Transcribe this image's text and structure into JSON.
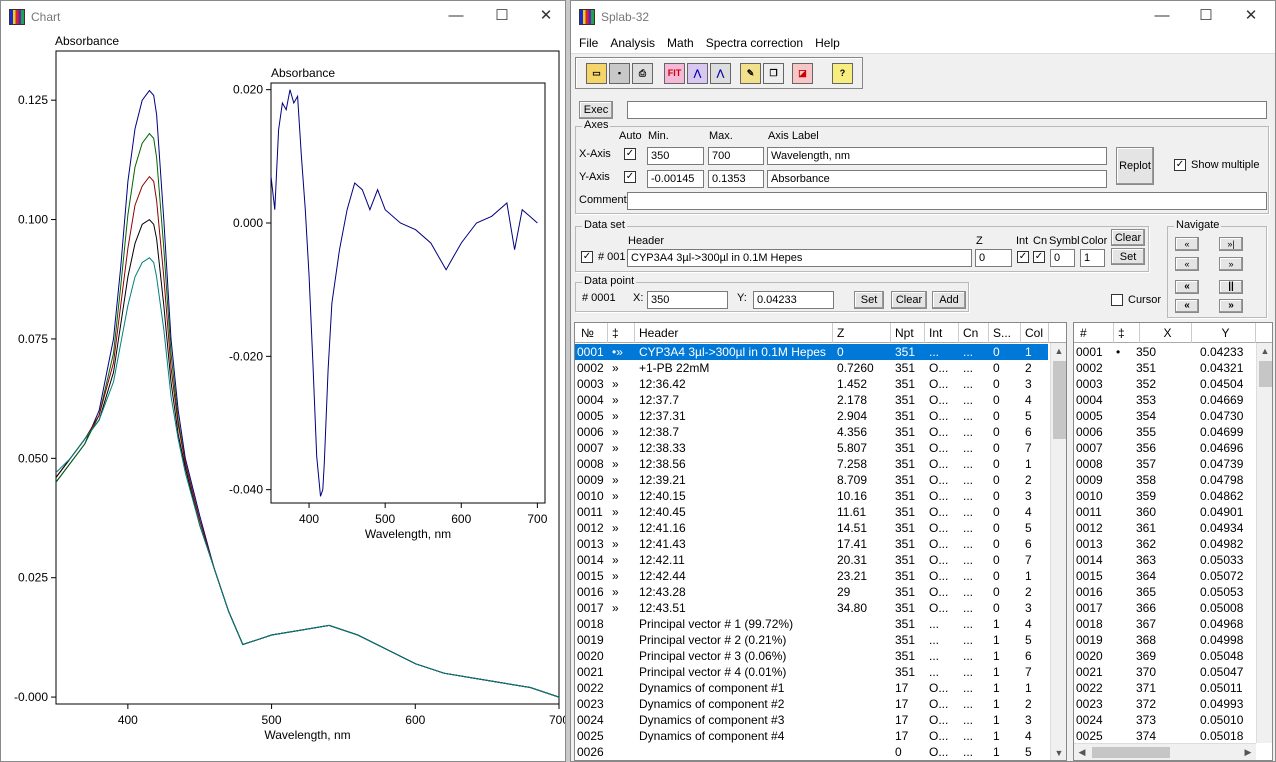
{
  "chart_window": {
    "title": "Chart",
    "controls": {
      "minimize": "—",
      "maximize": "☐",
      "close": "✕"
    }
  },
  "splab_window": {
    "title": "Splab-32",
    "controls": {
      "minimize": "—",
      "maximize": "☐",
      "close": "✕"
    },
    "menu": [
      "File",
      "Analysis",
      "Math",
      "Spectra correction",
      "Help"
    ],
    "toolbar_icons": [
      "open-folder-icon",
      "save-disk-icon",
      "print-icon",
      "fit-icon",
      "spectrum-icon",
      "spectrum-sum-icon",
      "pencil-icon",
      "copy-icon",
      "eraser-icon",
      "help-icon"
    ],
    "toolbar_labels": {
      "fit": "FIT",
      "help": "?"
    },
    "exec": {
      "label": "Exec",
      "value": ""
    },
    "axes": {
      "group_label": "Axes",
      "col_auto": "Auto",
      "col_min": "Min.",
      "col_max": "Max.",
      "col_axis_label": "Axis Label",
      "x_label": "X-Axis",
      "x_min": "350",
      "x_max": "700",
      "x_axis_label": "Wavelength, nm",
      "y_label": "Y-Axis",
      "y_min": "-0.00145",
      "y_max": "0.1353",
      "y_axis_label": "Absorbance",
      "comment_label": "Comment",
      "comment_value": "",
      "replot": "Replot",
      "show_multiple": "Show multiple"
    },
    "dataset": {
      "group_label": "Data set",
      "header_label": "Header",
      "z_label": "Z",
      "int_label": "Int",
      "cn_label": "Cn",
      "symbl_label": "Symbl",
      "color_label": "Color",
      "number": "# 001",
      "header_value": "CYP3A4 3µl->300µl in 0.1M Hepes",
      "z_value": "0",
      "symbl_value": "0",
      "color_value": "1",
      "clear": "Clear",
      "set": "Set"
    },
    "navigate": {
      "group_label": "Navigate",
      "buttons": [
        "«",
        "»|",
        "«",
        "»",
        "«",
        "||",
        "«",
        "»"
      ]
    },
    "datapoint": {
      "group_label": "Data point",
      "number": "# 0001",
      "x_label": "X:",
      "x_value": "350",
      "y_label": "Y:",
      "y_value": "0.04233",
      "set": "Set",
      "clear": "Clear",
      "add": "Add",
      "cursor": "Cursor"
    },
    "spectra_table": {
      "headers": [
        "№",
        "‡",
        "Header",
        "Z",
        "Npt",
        "Int",
        "Cn",
        "S...",
        "Col"
      ],
      "rows": [
        [
          "0001",
          "•»",
          "CYP3A4 3µl->300µl in 0.1M Hepes",
          "0",
          "351",
          "...",
          "...",
          "0",
          "1"
        ],
        [
          "0002",
          "»",
          "+1-PB 22mM",
          "0.7260",
          "351",
          "O...",
          "...",
          "0",
          "2"
        ],
        [
          "0003",
          "»",
          "12:36.42",
          "1.452",
          "351",
          "O...",
          "...",
          "0",
          "3"
        ],
        [
          "0004",
          "»",
          "12:37.7",
          "2.178",
          "351",
          "O...",
          "...",
          "0",
          "4"
        ],
        [
          "0005",
          "»",
          "12:37.31",
          "2.904",
          "351",
          "O...",
          "...",
          "0",
          "5"
        ],
        [
          "0006",
          "»",
          "12:38.7",
          "4.356",
          "351",
          "O...",
          "...",
          "0",
          "6"
        ],
        [
          "0007",
          "»",
          "12:38.33",
          "5.807",
          "351",
          "O...",
          "...",
          "0",
          "7"
        ],
        [
          "0008",
          "»",
          "12:38.56",
          "7.258",
          "351",
          "O...",
          "...",
          "0",
          "1"
        ],
        [
          "0009",
          "»",
          "12:39.21",
          "8.709",
          "351",
          "O...",
          "...",
          "0",
          "2"
        ],
        [
          "0010",
          "»",
          "12:40.15",
          "10.16",
          "351",
          "O...",
          "...",
          "0",
          "3"
        ],
        [
          "0011",
          "»",
          "12:40.45",
          "11.61",
          "351",
          "O...",
          "...",
          "0",
          "4"
        ],
        [
          "0012",
          "»",
          "12:41.16",
          "14.51",
          "351",
          "O...",
          "...",
          "0",
          "5"
        ],
        [
          "0013",
          "»",
          "12:41.43",
          "17.41",
          "351",
          "O...",
          "...",
          "0",
          "6"
        ],
        [
          "0014",
          "»",
          "12:42.11",
          "20.31",
          "351",
          "O...",
          "...",
          "0",
          "7"
        ],
        [
          "0015",
          "»",
          "12:42.44",
          "23.21",
          "351",
          "O...",
          "...",
          "0",
          "1"
        ],
        [
          "0016",
          "»",
          "12:43.28",
          "29",
          "351",
          "O...",
          "...",
          "0",
          "2"
        ],
        [
          "0017",
          "»",
          "12:43.51",
          "34.80",
          "351",
          "O...",
          "...",
          "0",
          "3"
        ],
        [
          "0018",
          "",
          "Principal vector # 1 (99.72%)",
          "",
          "351",
          "...",
          "...",
          "1",
          "4"
        ],
        [
          "0019",
          "",
          "Principal vector # 2 (0.21%)",
          "",
          "351",
          "...",
          "...",
          "1",
          "5"
        ],
        [
          "0020",
          "",
          "Principal vector # 3 (0.06%)",
          "",
          "351",
          "...",
          "...",
          "1",
          "6"
        ],
        [
          "0021",
          "",
          "Principal vector # 4 (0.01%)",
          "",
          "351",
          "...",
          "...",
          "1",
          "7"
        ],
        [
          "0022",
          "",
          "Dynamics of component #1",
          "",
          "17",
          "O...",
          "...",
          "1",
          "1"
        ],
        [
          "0023",
          "",
          "Dynamics of component #2",
          "",
          "17",
          "O...",
          "...",
          "1",
          "2"
        ],
        [
          "0024",
          "",
          "Dynamics of component #3",
          "",
          "17",
          "O...",
          "...",
          "1",
          "3"
        ],
        [
          "0025",
          "",
          "Dynamics of component #4",
          "",
          "17",
          "O...",
          "...",
          "1",
          "4"
        ],
        [
          "0026",
          "",
          "",
          "",
          "0",
          "O...",
          "...",
          "1",
          "5"
        ]
      ]
    },
    "points_table": {
      "headers": [
        "#",
        "‡",
        "X",
        "Y"
      ],
      "rows": [
        [
          "0001",
          "•",
          "350",
          "0.04233"
        ],
        [
          "0002",
          "",
          "351",
          "0.04321"
        ],
        [
          "0003",
          "",
          "352",
          "0.04504"
        ],
        [
          "0004",
          "",
          "353",
          "0.04669"
        ],
        [
          "0005",
          "",
          "354",
          "0.04730"
        ],
        [
          "0006",
          "",
          "355",
          "0.04699"
        ],
        [
          "0007",
          "",
          "356",
          "0.04696"
        ],
        [
          "0008",
          "",
          "357",
          "0.04739"
        ],
        [
          "0009",
          "",
          "358",
          "0.04798"
        ],
        [
          "0010",
          "",
          "359",
          "0.04862"
        ],
        [
          "0011",
          "",
          "360",
          "0.04901"
        ],
        [
          "0012",
          "",
          "361",
          "0.04934"
        ],
        [
          "0013",
          "",
          "362",
          "0.04982"
        ],
        [
          "0014",
          "",
          "363",
          "0.05033"
        ],
        [
          "0015",
          "",
          "364",
          "0.05072"
        ],
        [
          "0016",
          "",
          "365",
          "0.05053"
        ],
        [
          "0017",
          "",
          "366",
          "0.05008"
        ],
        [
          "0018",
          "",
          "367",
          "0.04968"
        ],
        [
          "0019",
          "",
          "368",
          "0.04998"
        ],
        [
          "0020",
          "",
          "369",
          "0.05048"
        ],
        [
          "0021",
          "",
          "370",
          "0.05047"
        ],
        [
          "0022",
          "",
          "371",
          "0.05011"
        ],
        [
          "0023",
          "",
          "372",
          "0.04993"
        ],
        [
          "0024",
          "",
          "373",
          "0.05010"
        ],
        [
          "0025",
          "",
          "374",
          "0.05018"
        ]
      ]
    }
  },
  "chart_data": [
    {
      "type": "line",
      "title": "Absorbance",
      "xlabel": "Wavelength, nm",
      "ylabel": "Absorbance",
      "xlim": [
        350,
        700
      ],
      "ylim": [
        -0.00145,
        0.1353
      ],
      "xticks": [
        "400",
        "500",
        "600",
        "700"
      ],
      "yticks": [
        "0.125",
        "0.100",
        "0.075",
        "0.050",
        "0.025",
        "-0.000"
      ],
      "grid": false,
      "series_colors": [
        "#000080",
        "#006400",
        "#8b0000",
        "#000000",
        "#008080",
        "#800080",
        "#808000"
      ],
      "x": [
        350,
        360,
        370,
        380,
        390,
        395,
        400,
        405,
        410,
        415,
        418,
        420,
        425,
        430,
        435,
        440,
        450,
        460,
        470,
        480,
        490,
        500,
        520,
        540,
        560,
        580,
        600,
        620,
        640,
        660,
        680,
        700
      ],
      "series": [
        {
          "values": [
            0.045,
            0.049,
            0.053,
            0.06,
            0.075,
            0.09,
            0.108,
            0.119,
            0.125,
            0.127,
            0.126,
            0.122,
            0.1,
            0.075,
            0.06,
            0.05,
            0.038,
            0.027,
            0.018,
            0.011,
            0.012,
            0.013,
            0.014,
            0.015,
            0.013,
            0.01,
            0.007,
            0.005,
            0.004,
            0.003,
            0.002,
            0.0
          ]
        },
        {
          "values": [
            0.045,
            0.049,
            0.053,
            0.059,
            0.072,
            0.086,
            0.101,
            0.111,
            0.116,
            0.118,
            0.117,
            0.113,
            0.094,
            0.072,
            0.058,
            0.049,
            0.037,
            0.027,
            0.018,
            0.011,
            0.012,
            0.013,
            0.014,
            0.015,
            0.013,
            0.01,
            0.007,
            0.005,
            0.004,
            0.003,
            0.002,
            0.0
          ]
        },
        {
          "values": [
            0.046,
            0.05,
            0.054,
            0.059,
            0.07,
            0.082,
            0.094,
            0.103,
            0.107,
            0.109,
            0.108,
            0.104,
            0.088,
            0.069,
            0.057,
            0.049,
            0.037,
            0.027,
            0.018,
            0.011,
            0.012,
            0.013,
            0.014,
            0.015,
            0.013,
            0.01,
            0.007,
            0.005,
            0.004,
            0.003,
            0.002,
            0.0
          ]
        },
        {
          "values": [
            0.046,
            0.05,
            0.054,
            0.058,
            0.068,
            0.078,
            0.088,
            0.095,
            0.099,
            0.1,
            0.099,
            0.096,
            0.082,
            0.066,
            0.055,
            0.048,
            0.036,
            0.027,
            0.018,
            0.011,
            0.012,
            0.013,
            0.014,
            0.015,
            0.013,
            0.01,
            0.007,
            0.005,
            0.004,
            0.003,
            0.002,
            0.0
          ]
        },
        {
          "values": [
            0.047,
            0.05,
            0.054,
            0.058,
            0.066,
            0.074,
            0.082,
            0.088,
            0.091,
            0.092,
            0.091,
            0.088,
            0.077,
            0.063,
            0.054,
            0.047,
            0.036,
            0.027,
            0.018,
            0.011,
            0.012,
            0.013,
            0.014,
            0.015,
            0.013,
            0.01,
            0.007,
            0.005,
            0.004,
            0.003,
            0.002,
            0.0
          ]
        }
      ]
    },
    {
      "type": "line",
      "title": "Absorbance",
      "xlabel": "Wavelength, nm",
      "ylabel": "Absorbance",
      "xlim": [
        350,
        710
      ],
      "ylim": [
        -0.042,
        0.021
      ],
      "xticks": [
        "400",
        "500",
        "600",
        "700"
      ],
      "yticks": [
        "0.020",
        "0.000",
        "-0.020",
        "-0.040"
      ],
      "grid": false,
      "series_colors": [
        "#000080"
      ],
      "x": [
        350,
        355,
        360,
        365,
        370,
        375,
        380,
        385,
        390,
        395,
        400,
        405,
        410,
        415,
        418,
        420,
        425,
        430,
        440,
        450,
        460,
        470,
        480,
        490,
        500,
        520,
        540,
        560,
        580,
        590,
        600,
        620,
        640,
        660,
        670,
        680,
        690,
        700
      ],
      "series": [
        {
          "values": [
            0.007,
            0.002,
            0.014,
            0.018,
            0.017,
            0.02,
            0.018,
            0.019,
            0.01,
            0.002,
            -0.008,
            -0.021,
            -0.035,
            -0.041,
            -0.04,
            -0.036,
            -0.022,
            -0.012,
            -0.004,
            0.002,
            0.006,
            0.005,
            0.002,
            0.005,
            0.002,
            0.0,
            -0.001,
            -0.003,
            -0.007,
            -0.005,
            -0.003,
            0.0,
            0.001,
            0.003,
            -0.004,
            0.002,
            0.001,
            0.0
          ]
        }
      ]
    }
  ]
}
